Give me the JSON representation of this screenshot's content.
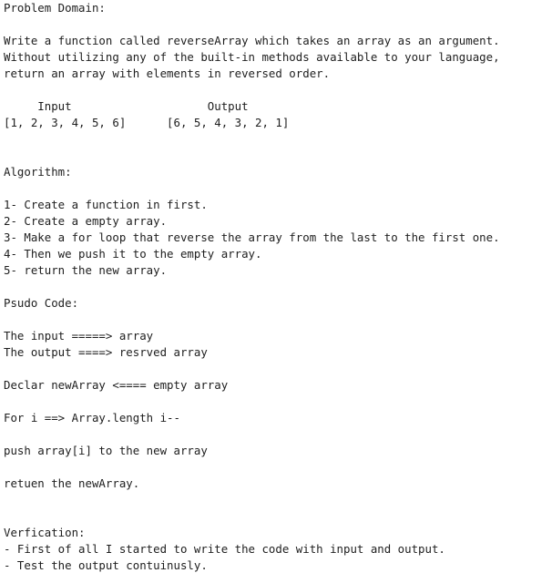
{
  "problem": {
    "heading": "Problem Domain:",
    "lines": [
      "Write a function called reverseArray which takes an array as an argument.",
      "Without utilizing any of the built-in methods available to your language,",
      "return an array with elements in reversed order."
    ],
    "example_header": "     Input                    Output",
    "example_row": "[1, 2, 3, 4, 5, 6]      [6, 5, 4, 3, 2, 1]"
  },
  "algorithm": {
    "heading": "Algorithm:",
    "steps": [
      "1- Create a function in first.",
      "2- Create a empty array.",
      "3- Make a for loop that reverse the array from the last to the first one.",
      "4- Then we push it to the empty array.",
      "5- return the new array."
    ]
  },
  "pseudo": {
    "heading": "Psudo Code:",
    "input_line": "The input =====> array",
    "output_line": "The output ====> resrved array",
    "declare_line": "Declar newArray <==== empty array",
    "for_line": "For i ==> Array.length i--",
    "push_line": "push array[i] to the new array",
    "return_line": "retuen the newArray."
  },
  "verification": {
    "heading": "Verfication:",
    "items": [
      "- First of all I started to write the code with input and output.",
      "- Test the output contuinusly."
    ]
  }
}
